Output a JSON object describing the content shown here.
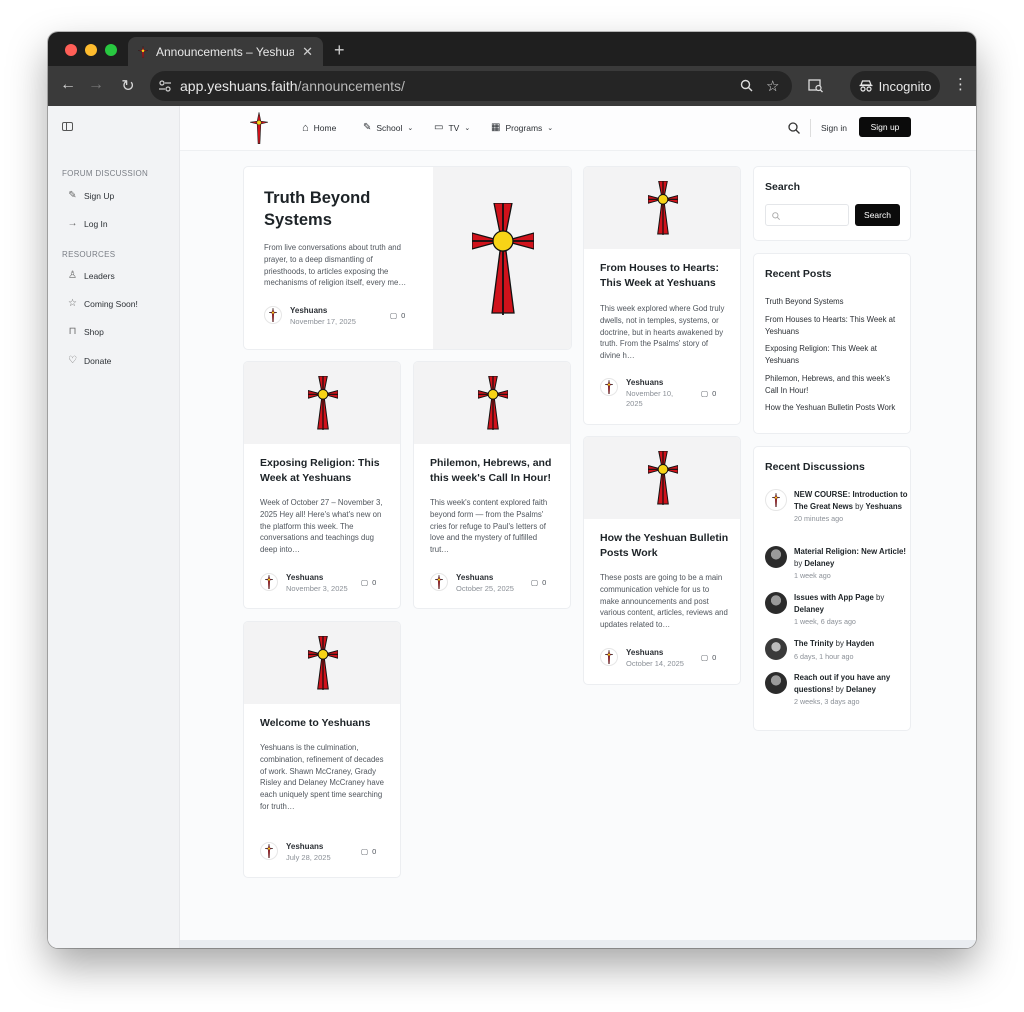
{
  "browser": {
    "tab_title": "Announcements – Yeshuans",
    "url_domain": "app.yeshuans.faith",
    "url_path": "/announcements/",
    "incognito_label": "Incognito"
  },
  "sidebar": {
    "section1": "FORUM DISCUSSION",
    "section1_items": [
      {
        "label": "Sign Up",
        "icon": "signup-icon"
      },
      {
        "label": "Log In",
        "icon": "arrow-right-icon"
      }
    ],
    "section2": "RESOURCES",
    "section2_items": [
      {
        "label": "Leaders",
        "icon": "user-icon"
      },
      {
        "label": "Coming Soon!",
        "icon": "star-icon"
      },
      {
        "label": "Shop",
        "icon": "bag-icon"
      },
      {
        "label": "Donate",
        "icon": "heart-icon"
      }
    ]
  },
  "header": {
    "nav": [
      "Home",
      "School",
      "TV",
      "Programs"
    ],
    "sign_in": "Sign in",
    "sign_up": "Sign up"
  },
  "posts": {
    "featured": {
      "title_line1": "Truth Beyond",
      "title_line2": "Systems",
      "excerpt": "From live conversations about truth and prayer, to a deep dismantling of priesthoods, to articles exposing the mechanisms of religion itself, every me…",
      "author": "Yeshuans",
      "date": "November 17, 2025",
      "comments": "0"
    },
    "houses": {
      "title": "From Houses to Hearts: This Week at Yeshuans",
      "excerpt": "This week explored where God truly dwells, not in temples, systems, or doctrine, but in hearts awakened by truth. From the Psalms' story of divine h…",
      "author": "Yeshuans",
      "date": "November 10, 2025",
      "comments": "0"
    },
    "exposing": {
      "title": "Exposing Religion: This Week at Yeshuans",
      "excerpt": "Week of October 27 – November 3, 2025 Hey all! Here's what's new on the platform this week. The conversations and teachings dug deep into…",
      "author": "Yeshuans",
      "date": "November 3, 2025",
      "comments": "0"
    },
    "philemon": {
      "title": "Philemon, Hebrews, and this week's Call In Hour!",
      "excerpt": "This week's content explored faith beyond form — from the Psalms' cries for refuge to Paul's letters of love and the mystery of fulfilled trut…",
      "author": "Yeshuans",
      "date": "October 25, 2025",
      "comments": "0"
    },
    "bulletin": {
      "title": "How the Yeshuan Bulletin Posts Work",
      "excerpt": "These posts are going to be a main communication vehicle for us to make announcements and post various content, articles, reviews and updates related to…",
      "author": "Yeshuans",
      "date": "October 14, 2025",
      "comments": "0"
    },
    "welcome": {
      "title": "Welcome to Yeshuans",
      "excerpt": "Yeshuans is the culmination, combination, refinement of decades of work. Shawn McCraney, Grady Risley and Delaney McCraney have each uniquely spent time searching for truth…",
      "author": "Yeshuans",
      "date": "July 28, 2025",
      "comments": "0"
    }
  },
  "search_widget": {
    "title": "Search",
    "button": "Search"
  },
  "recent_posts": {
    "title": "Recent Posts",
    "items": [
      "Truth Beyond Systems",
      "From Houses to Hearts: This Week at Yeshuans",
      "Exposing Religion: This Week at Yeshuans",
      "Philemon, Hebrews, and this week's Call In Hour!",
      "How the Yeshuan Bulletin Posts Work"
    ]
  },
  "recent_discussions": {
    "title": "Recent Discussions",
    "by": "by",
    "items": [
      {
        "topic": "NEW COURSE: Introduction to The Great News",
        "author": "Yeshuans",
        "time": "20 minutes ago"
      },
      {
        "topic": "Material Religion: New Article!",
        "author": "Delaney",
        "time": "1 week ago"
      },
      {
        "topic": "Issues with App Page",
        "author": "Delaney",
        "time": "1 week, 6 days ago"
      },
      {
        "topic": "The Trinity",
        "author": "Hayden",
        "time": "6 days, 1 hour ago"
      },
      {
        "topic": "Reach out if you have any questions!",
        "author": "Delaney",
        "time": "2 weeks, 3 days ago"
      }
    ]
  },
  "colors": {
    "cross_red": "#d0121b",
    "cross_center": "#f7d417",
    "accent_dark": "#0b0b0b"
  }
}
